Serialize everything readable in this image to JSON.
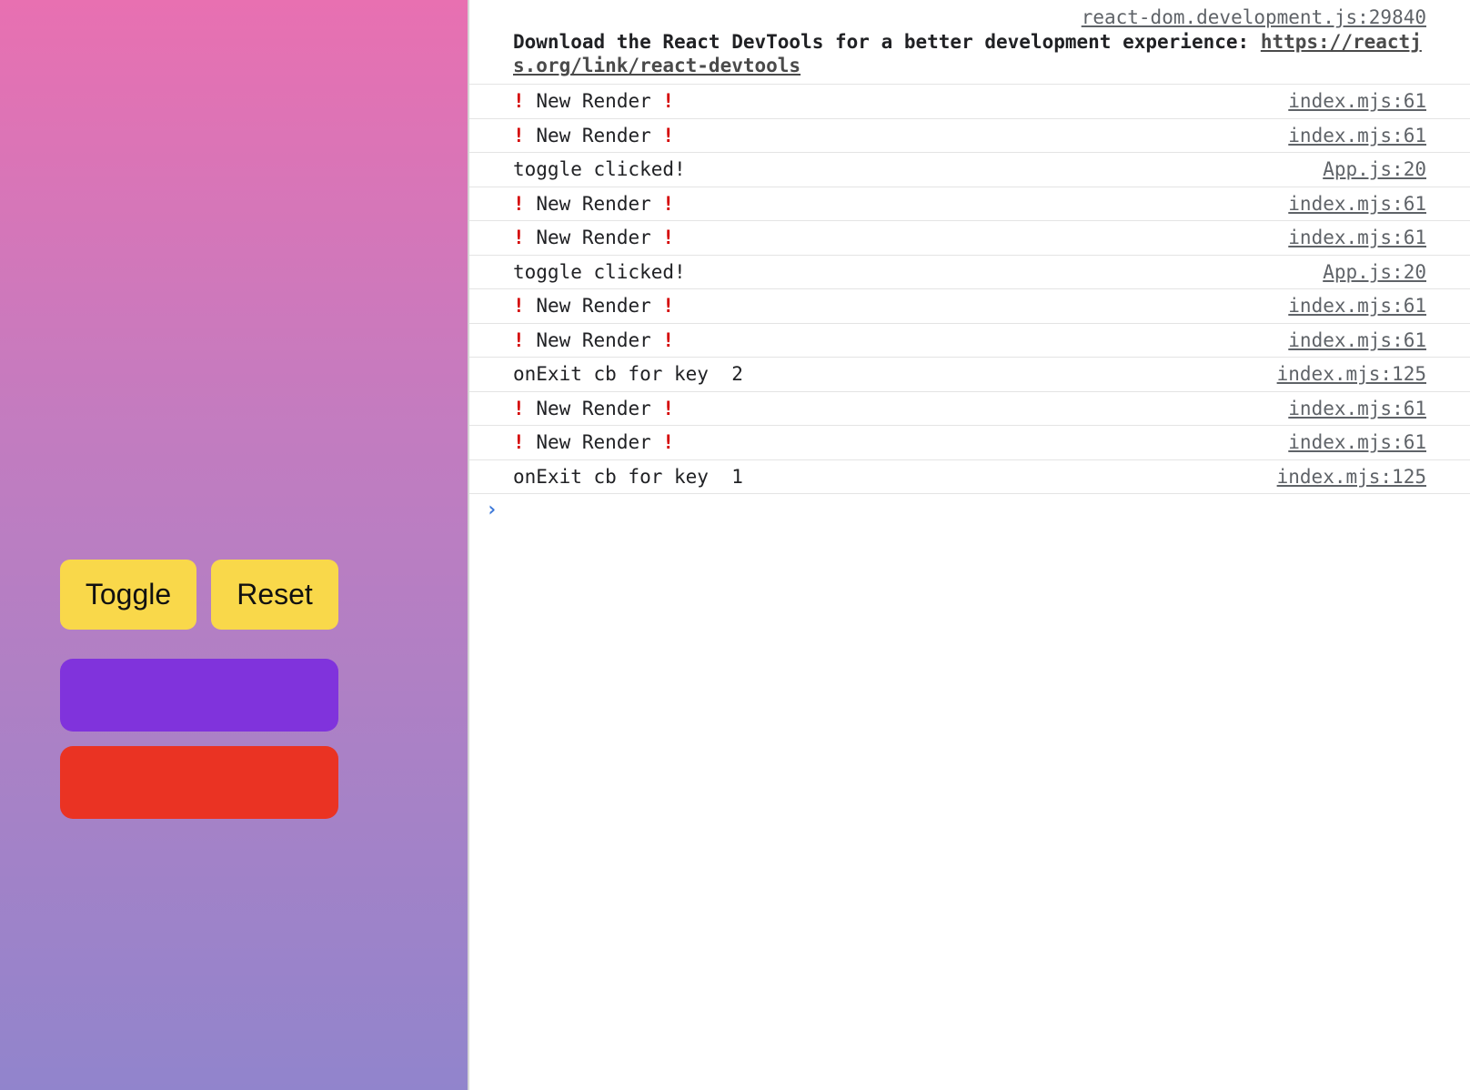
{
  "app": {
    "toggle_label": "Toggle",
    "reset_label": "Reset",
    "boxes": [
      {
        "color": "#8033dc"
      },
      {
        "color": "#ea3323"
      }
    ]
  },
  "console": {
    "devtools_message": {
      "source": "react-dom.development.js:29840",
      "text": "Download the React DevTools for a better development experience: ",
      "link": "https://reactjs.org/link/react-devtools"
    },
    "rows": [
      {
        "type": "render",
        "text": "New Render",
        "icon": "!",
        "source": "index.mjs:61"
      },
      {
        "type": "render",
        "text": "New Render",
        "icon": "!",
        "source": "index.mjs:61"
      },
      {
        "type": "plain",
        "text": "toggle clicked!",
        "source": "App.js:20"
      },
      {
        "type": "render",
        "text": "New Render",
        "icon": "!",
        "source": "index.mjs:61"
      },
      {
        "type": "render",
        "text": "New Render",
        "icon": "!",
        "source": "index.mjs:61"
      },
      {
        "type": "plain",
        "text": "toggle clicked!",
        "source": "App.js:20"
      },
      {
        "type": "render",
        "text": "New Render",
        "icon": "!",
        "source": "index.mjs:61"
      },
      {
        "type": "render",
        "text": "New Render",
        "icon": "!",
        "source": "index.mjs:61"
      },
      {
        "type": "plain",
        "text": "onExit cb for key  2",
        "source": "index.mjs:125"
      },
      {
        "type": "render",
        "text": "New Render",
        "icon": "!",
        "source": "index.mjs:61"
      },
      {
        "type": "render",
        "text": "New Render",
        "icon": "!",
        "source": "index.mjs:61"
      },
      {
        "type": "plain",
        "text": "onExit cb for key  1",
        "source": "index.mjs:125"
      }
    ],
    "prompt_icon": "chevron-right-icon",
    "prompt_glyph": "›"
  }
}
